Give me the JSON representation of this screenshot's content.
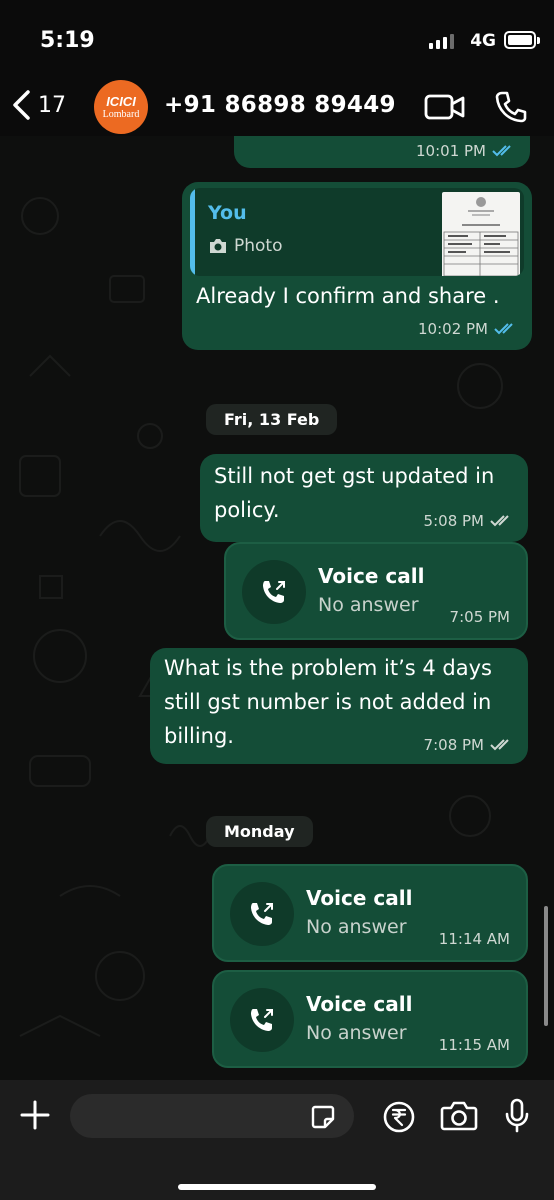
{
  "status_bar": {
    "time": "5:19",
    "network": "4G"
  },
  "header": {
    "back_count": "17",
    "avatar_line1": "ICICI",
    "avatar_line2": "Lombard",
    "contact_name": "+91 86898 89449"
  },
  "messages": {
    "m0": {
      "time": "10:01 PM"
    },
    "m1": {
      "quote_author": "You",
      "quote_type": "Photo",
      "text": "Already I confirm and share .",
      "time": "10:02 PM"
    },
    "date1": "Fri, 13 Feb",
    "m2": {
      "text_line1": "Still not get gst updated in",
      "text_line2": "policy.",
      "time": "5:08 PM"
    },
    "m3": {
      "title": "Voice call",
      "subtitle": "No answer",
      "time": "7:05 PM"
    },
    "m4": {
      "text_line1": "What is the problem it’s 4 days",
      "text_line2": "still gst number is not added in",
      "text_line3": "billing.",
      "time": "7:08 PM"
    },
    "date2": "Monday",
    "m5": {
      "title": "Voice call",
      "subtitle": "No answer",
      "time": "11:14 AM"
    },
    "m6": {
      "title": "Voice call",
      "subtitle": "No answer",
      "time": "11:15 AM"
    }
  },
  "input": {
    "placeholder": ""
  },
  "icons": [
    "back-chevron-icon",
    "video-call-icon",
    "phone-icon",
    "plus-icon",
    "sticker-icon",
    "rupee-icon",
    "camera-icon",
    "microphone-icon",
    "outgoing-call-icon",
    "read-ticks-icon",
    "camera-small-icon"
  ],
  "colors": {
    "bubble_out": "#144d37",
    "read_tick": "#53bdeb",
    "quote_author": "#53bdeb",
    "avatar": "#ec6a22"
  }
}
